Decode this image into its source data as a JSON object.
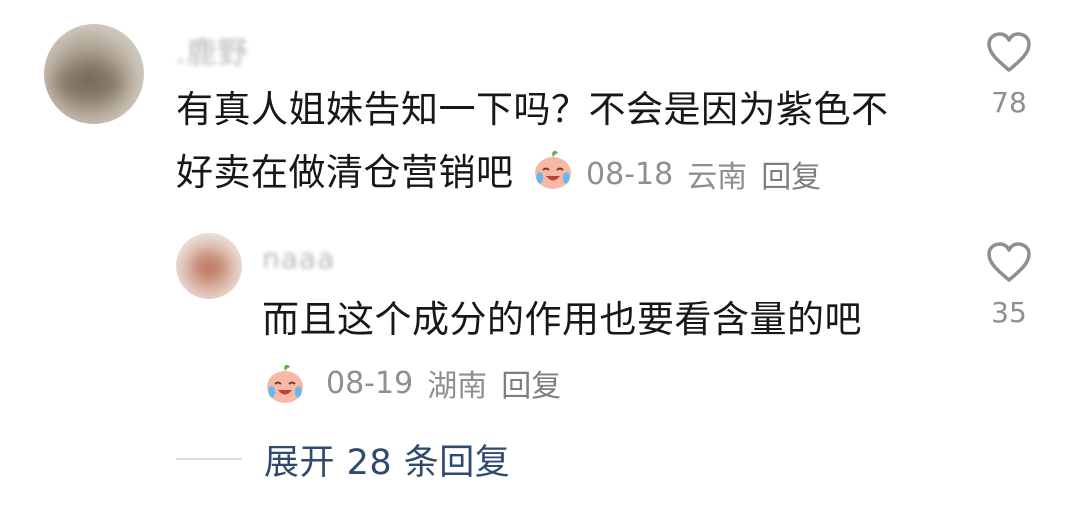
{
  "comments": [
    {
      "username": ".鹿野",
      "text_line1": "有真人姐妹告知一下吗？不会是因为紫色不",
      "text_line2": "好卖在做清仓营销吧",
      "emoji": "crying-laughing-peach-emoji",
      "date": "08-18",
      "location": "云南",
      "reply_label": "回复",
      "likes": "78"
    },
    {
      "username": "naaa",
      "text": "而且这个成分的作用也要看含量的吧",
      "emoji": "crying-laughing-peach-emoji",
      "date": "08-19",
      "location": "湖南",
      "reply_label": "回复",
      "likes": "35"
    }
  ],
  "expand_replies": "展开 28 条回复",
  "colors": {
    "text": "#171717",
    "meta": "#8f8f8f",
    "link": "#2e4a6f",
    "icon": "#8f8f8f"
  }
}
